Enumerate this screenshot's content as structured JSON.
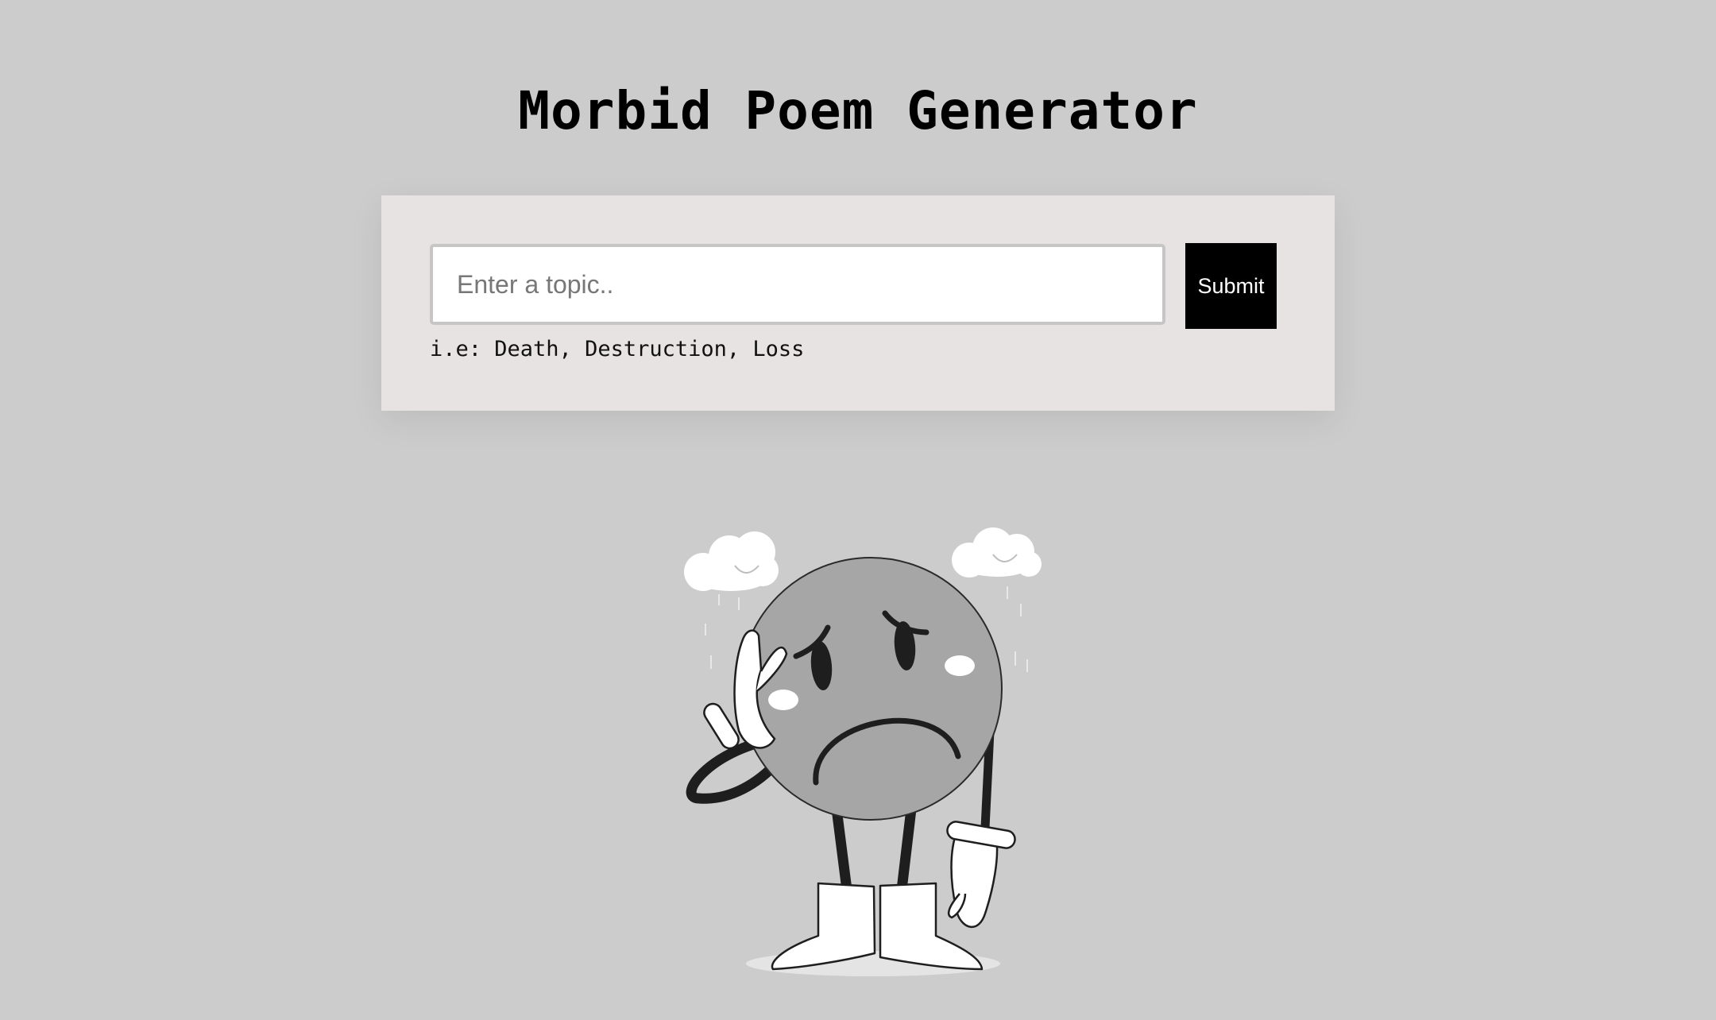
{
  "header": {
    "title": "Morbid Poem Generator"
  },
  "form": {
    "input_placeholder": "Enter a topic..",
    "input_value": "",
    "submit_label": "Submit",
    "hint": "i.e: Death, Destruction, Loss"
  },
  "illustration": {
    "icon": "sad-cartoon-character",
    "colors": {
      "background": "#cccccc",
      "card": "#e6e3e2",
      "button": "#000000",
      "character_face": "#a6a6a6"
    }
  }
}
